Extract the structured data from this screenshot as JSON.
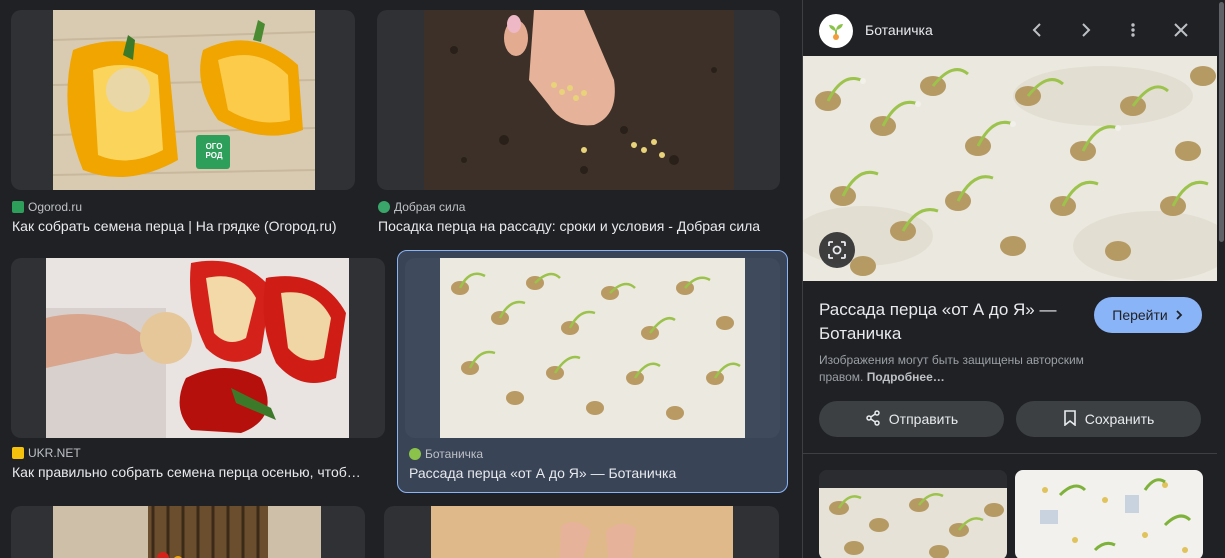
{
  "results": [
    {
      "source": "Ogorod.ru",
      "title": "Как собрать семена перца | На грядке (Огород.ru)",
      "favicon_color": "#2e9e5b",
      "badge": "ОГО РОД"
    },
    {
      "source": "Добрая сила",
      "title": "Посадка перца на рассаду: сроки и условия - Добрая сила",
      "favicon_color": "#3aa66a"
    },
    {
      "source": "UKR.NET",
      "title": "Как правильно собрать семена перца осенью, чтоб…",
      "favicon_color": "#f4c20d"
    },
    {
      "source": "Ботаничка",
      "title": "Рассада перца «от А до Я» — Ботаничка",
      "favicon_color": "#8bc34a",
      "selected": true
    }
  ],
  "panel": {
    "site_name": "Ботаничка",
    "title": "Рассада перца «от А до Я» — Ботаничка",
    "visit_label": "Перейти",
    "notice_text": "Изображения могут быть защищены авторским правом.",
    "notice_more": "Подробнее…",
    "share_label": "Отправить",
    "save_label": "Сохранить",
    "icons": [
      "prev-icon",
      "next-icon",
      "more-icon",
      "close-icon",
      "lens-icon",
      "share-icon",
      "bookmark-icon"
    ]
  },
  "colors": {
    "accent": "#8ab4f8",
    "selected_bg": "#394457",
    "bg": "#202124",
    "card": "#303134"
  }
}
